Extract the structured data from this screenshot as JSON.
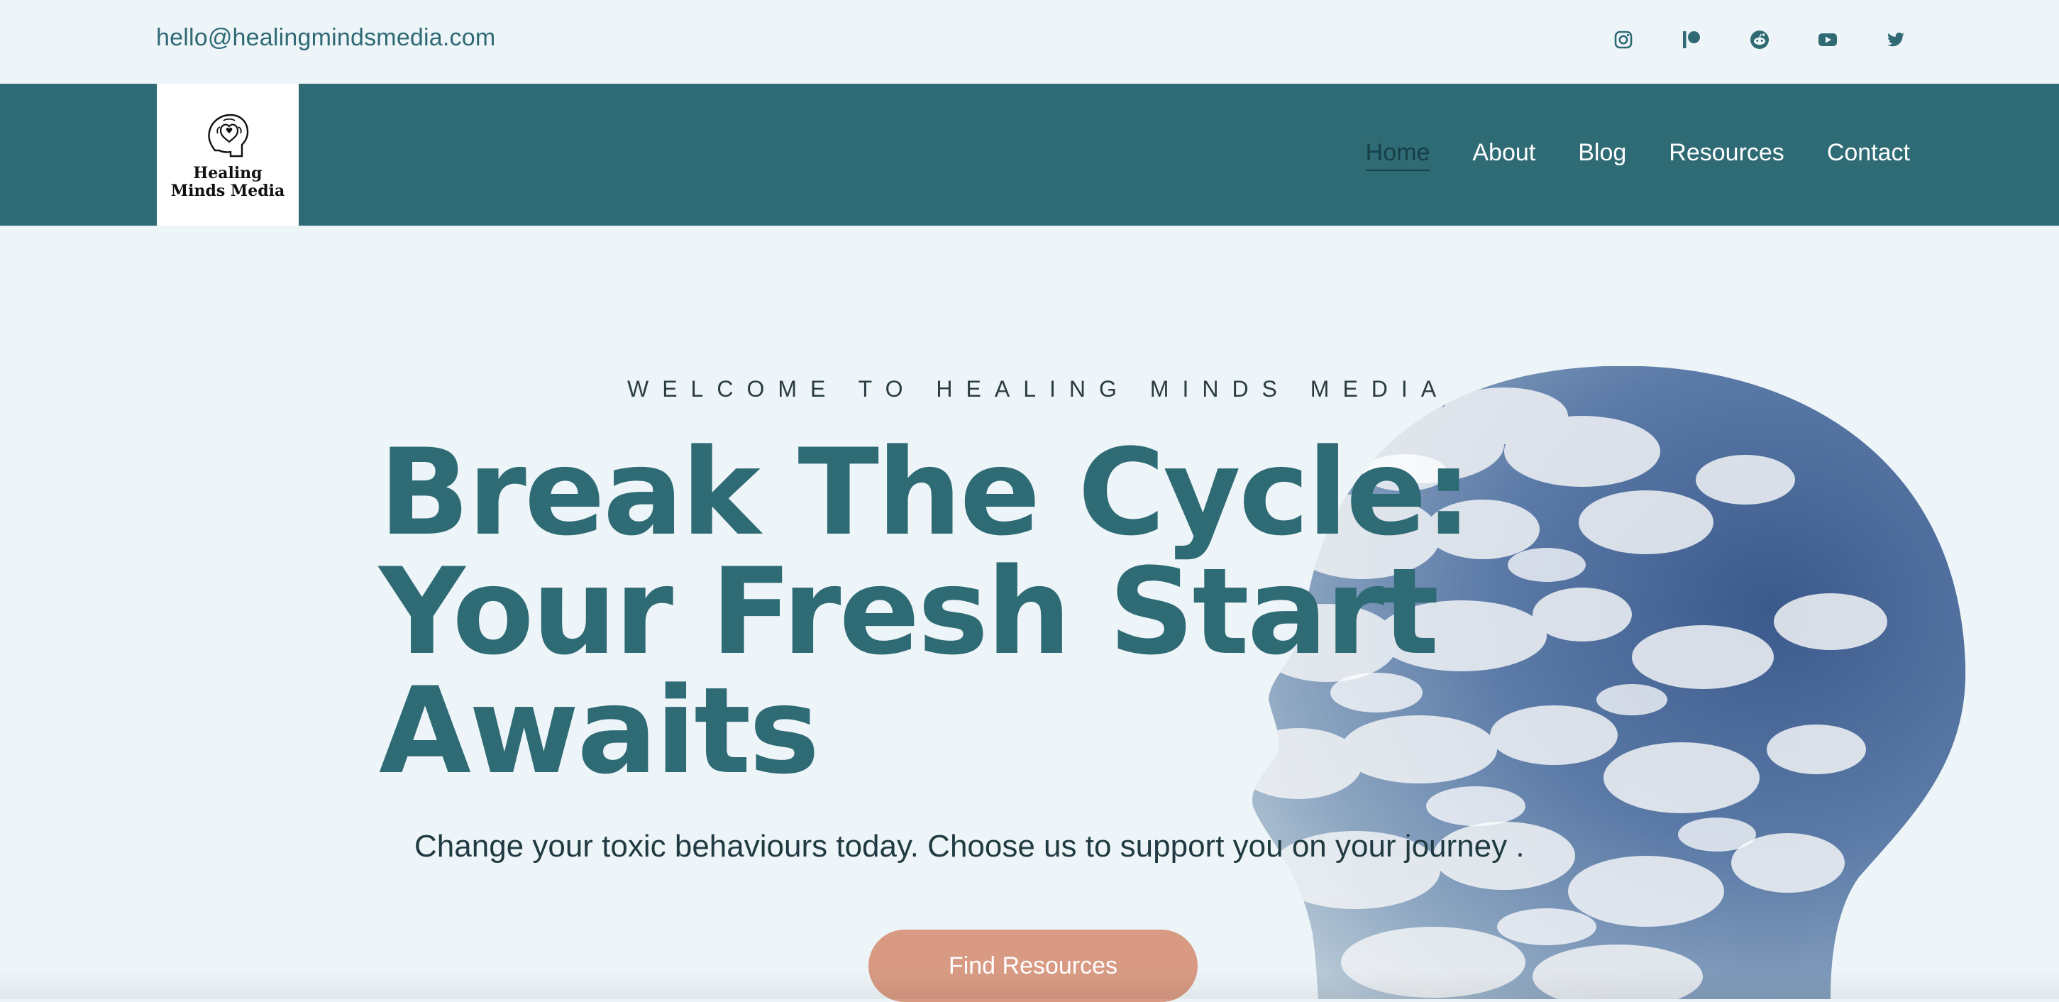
{
  "topbar": {
    "email": "hello@healingmindsmedia.com",
    "social_icons": [
      "instagram-icon",
      "patreon-icon",
      "reddit-icon",
      "youtube-icon",
      "twitter-icon"
    ]
  },
  "logo": {
    "line1": "Healing",
    "line2": "Minds Media"
  },
  "nav": {
    "items": [
      {
        "label": "Home",
        "active": true
      },
      {
        "label": "About"
      },
      {
        "label": "Blog"
      },
      {
        "label": "Resources"
      },
      {
        "label": "Contact"
      }
    ]
  },
  "hero": {
    "eyebrow": "WELCOME TO HEALING MINDS MEDIA",
    "headline_line1": "Break The Cycle:",
    "headline_line2": "Your Fresh Start",
    "headline_line3": "Awaits",
    "subtext": "Change your toxic behaviours today. Choose us to support you on your journey .",
    "cta_label": "Find Resources"
  },
  "colors": {
    "background": "#eef5f9",
    "teal": "#2f6b75",
    "cta": "#d89a83",
    "active_nav": "#163f46"
  }
}
